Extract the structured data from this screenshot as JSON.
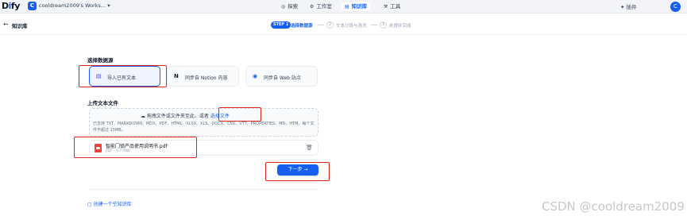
{
  "app": {
    "logo_text": "Dify",
    "logo_first": "D",
    "logo_i": "i",
    "logo_rest": "fy"
  },
  "workspace": {
    "avatar": "C",
    "name": "cooldream2009's Works... ▾"
  },
  "nav": {
    "tabs": [
      {
        "icon": "compass-icon",
        "glyph": "◎",
        "label": "探索",
        "active": false
      },
      {
        "icon": "grid-icon",
        "glyph": "⚙",
        "label": "工作室",
        "active": false
      },
      {
        "icon": "book-icon",
        "glyph": "▤",
        "label": "知识库",
        "active": true
      },
      {
        "icon": "hammer-icon",
        "glyph": "⚒",
        "label": "工具",
        "active": false
      }
    ],
    "plugins_label": "插件",
    "user_avatar": "C"
  },
  "breadcrumb": {
    "back_glyph": "←",
    "title": "知识库"
  },
  "steps": [
    {
      "num": "STEP 1",
      "label": "选择数据源",
      "active": true
    },
    {
      "num": "2",
      "label": "文本分段与清洗",
      "active": false
    },
    {
      "num": "3",
      "label": "处理并完成",
      "active": false
    }
  ],
  "data_source": {
    "title": "选择数据源",
    "options": [
      {
        "icon": "file-text-icon",
        "glyph": "▤",
        "label": "导入已有文本",
        "active": true
      },
      {
        "icon": "notion-icon",
        "glyph": "N",
        "label": "同步自 Notion 内容",
        "active": false
      },
      {
        "icon": "web-icon",
        "glyph": "◉",
        "label": "同步自 Web 站点",
        "active": false
      }
    ]
  },
  "upload": {
    "title": "上传文本文件",
    "cloud_glyph": "☁",
    "prompt": "拖拽文件或文件夹至此，或者 ",
    "link": "选择文件",
    "hint": "已支持 TXT、MARKDOWN、MDX、PDF、HTML、XLSX、XLS、DOCX、CSV、VTT、PROPERTIES、MD、HTM，每个文件不超过 15MB。"
  },
  "file": {
    "name": "智能门锁产品使用说明书.pdf",
    "meta": "PDF · 0.77MB",
    "trash_glyph": "🗑"
  },
  "next_button": "下一步 →",
  "create_empty": {
    "glyph": "▢",
    "label": "创建一个空知识库"
  },
  "watermark": "CSDN @cooldream2009",
  "colors": {
    "accent": "#155eef",
    "annotation": "#e0241b"
  }
}
